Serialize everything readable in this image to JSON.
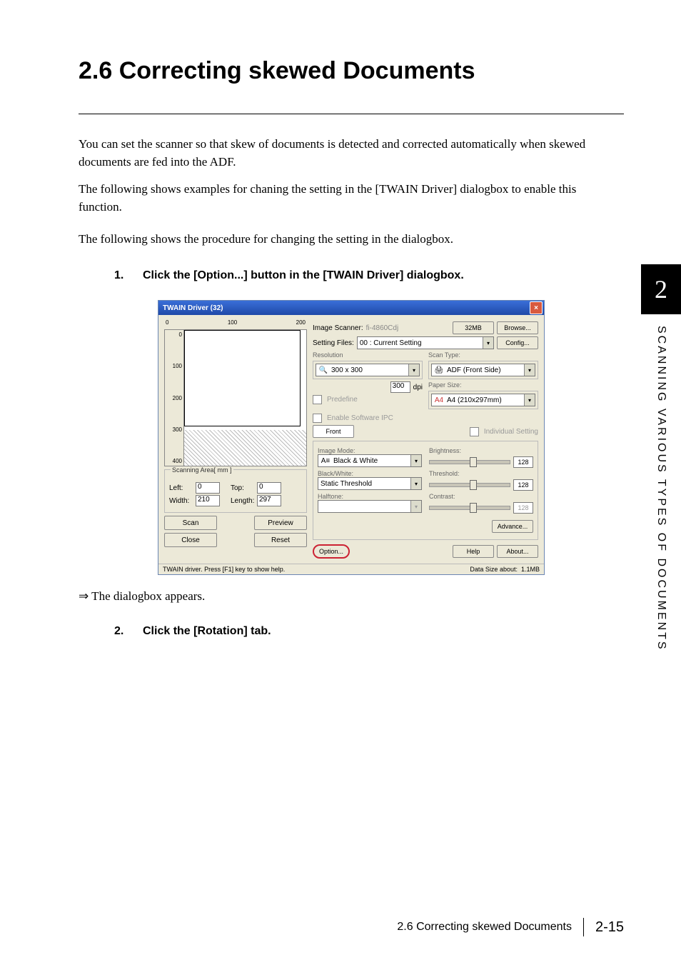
{
  "heading": "2.6   Correcting skewed Documents",
  "para1": "You can set the scanner so that skew of documents is detected and corrected automatically when skewed documents are fed into the ADF.",
  "para2": "The following shows examples for chaning the setting in the [TWAIN Driver] dialogbox to enable this function.",
  "para3": "The following shows the procedure for changing the setting in the dialogbox.",
  "step1_num": "1.",
  "step1_text": "Click the [Option...] button in the [TWAIN Driver] dialogbox.",
  "step2_num": "2.",
  "step2_text": "Click the [Rotation] tab.",
  "result_line": "⇒ The dialogbox appears.",
  "side_chapter": "2",
  "side_text": "SCANNING VARIOUS TYPES OF DOCUMENTS",
  "footer_prefix": "2.6 Correcting skewed Documents",
  "footer_page": "2-15",
  "dialog": {
    "title": "TWAIN Driver (32)",
    "close": "×",
    "ruler": {
      "t0": "0",
      "t1": "100",
      "t2": "200",
      "v1": "100",
      "v2": "200",
      "v3": "300",
      "v4": "400"
    },
    "scan_group": "Scanning Area[ mm ]",
    "left_lbl": "Left:",
    "left_val": "0",
    "top_lbl": "Top:",
    "top_val": "0",
    "width_lbl": "Width:",
    "width_val": "210",
    "length_lbl": "Length:",
    "length_val": "297",
    "btn_scan": "Scan",
    "btn_preview": "Preview",
    "btn_close": "Close",
    "btn_reset": "Reset",
    "img_scanner_lbl": "Image Scanner:",
    "img_scanner_val": "fi-4860Cdj",
    "mem": "32MB",
    "btn_browse": "Browse...",
    "setting_files_lbl": "Setting Files:",
    "setting_files_val": "00 : Current Setting",
    "btn_config": "Config...",
    "resolution_lbl": "Resolution",
    "resolution_val": "300 x 300",
    "dpi_val": "300",
    "dpi_suffix": "dpi",
    "predefine": "Predefine",
    "scantype_lbl": "Scan Type:",
    "scantype_val": "ADF (Front Side)",
    "papersize_lbl": "Paper Size:",
    "papersize_val": "A4 (210x297mm)",
    "enable_ipc": "Enable Software IPC",
    "front_tab": "Front",
    "indiv": "Individual Setting",
    "imgmode_lbl": "Image Mode:",
    "imgmode_val": "Black & White",
    "bw_lbl": "Black/White:",
    "bw_val": "Static Threshold",
    "halftone_lbl": "Halftone:",
    "bright_lbl": "Brightness:",
    "bright_val": "128",
    "thresh_lbl": "Threshold:",
    "thresh_val": "128",
    "contrast_lbl": "Contrast:",
    "contrast_val": "128",
    "btn_advance": "Advance...",
    "btn_option": "Option...",
    "btn_help": "Help",
    "btn_about": "About...",
    "status_left": "TWAIN driver. Press [F1] key to show help.",
    "status_right_lbl": "Data Size about:",
    "status_right_val": "1.1MB"
  }
}
